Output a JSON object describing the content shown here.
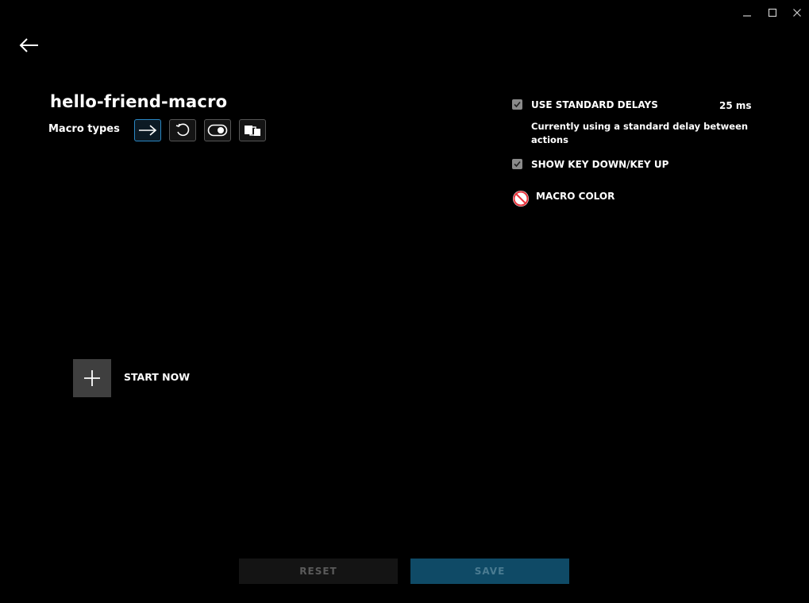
{
  "window_controls": {
    "minimize_icon": "minimize-icon",
    "maximize_icon": "maximize-icon",
    "close_icon": "close-icon"
  },
  "nav": {
    "back_icon": "back-arrow-icon"
  },
  "macro": {
    "name": "hello-friend-macro",
    "types_label": "Macro types",
    "types": [
      {
        "icon": "arrow-right-icon",
        "selected": true
      },
      {
        "icon": "repeat-icon",
        "selected": false
      },
      {
        "icon": "toggle-icon",
        "selected": false
      },
      {
        "icon": "sequence-icon",
        "selected": false
      }
    ]
  },
  "options": {
    "standard_delays": {
      "label": "USE STANDARD DELAYS",
      "checked": true,
      "value": "25 ms",
      "description": "Currently using a standard delay between actions"
    },
    "key_down_up": {
      "label": "SHOW KEY DOWN/KEY UP",
      "checked": true
    },
    "macro_color": {
      "label": "MACRO COLOR",
      "icon": "no-color-icon"
    }
  },
  "start": {
    "label": "START NOW",
    "icon": "plus-icon"
  },
  "footer": {
    "reset_label": "RESET",
    "save_label": "SAVE"
  },
  "colors": {
    "background": "#000000",
    "accent_blue": "#2a87c4",
    "save_button": "#0f4a66",
    "no_color_red": "#e8333c"
  }
}
